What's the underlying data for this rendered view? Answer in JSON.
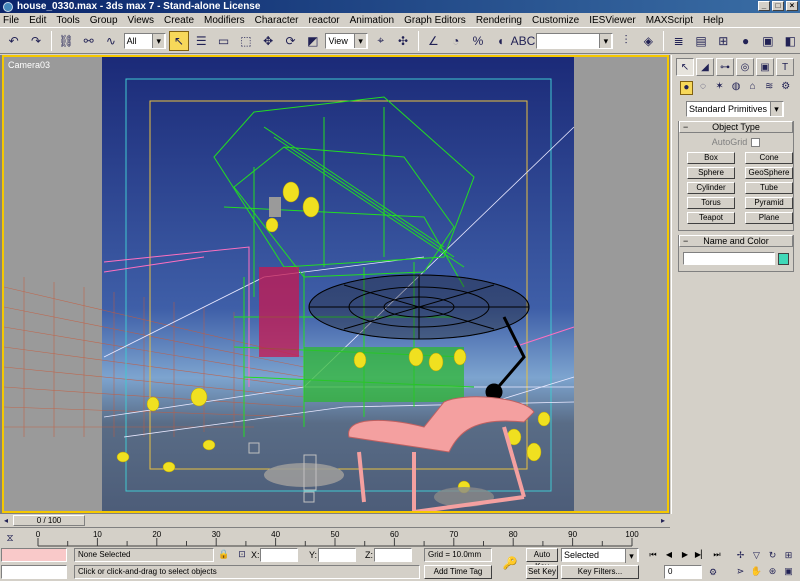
{
  "window": {
    "title": "house_0330.max - 3ds max 7 - Stand-alone License"
  },
  "menu": [
    "File",
    "Edit",
    "Tools",
    "Group",
    "Views",
    "Create",
    "Modifiers",
    "Character",
    "reactor",
    "Animation",
    "Graph Editors",
    "Rendering",
    "Customize",
    "IESViewer",
    "MAXScript",
    "Help"
  ],
  "toolbar": {
    "selection_filter": "All",
    "reference_coord": "View",
    "named_selection": ""
  },
  "viewport": {
    "label": "Camera03",
    "frame_border_color": "#f5c800"
  },
  "command_panel": {
    "category": "Standard Primitives",
    "object_type_title": "Object Type",
    "autogrid_label": "AutoGrid",
    "buttons": [
      "Box",
      "Cone",
      "Sphere",
      "GeoSphere",
      "Cylinder",
      "Tube",
      "Torus",
      "Pyramid",
      "Teapot",
      "Plane"
    ],
    "name_color_title": "Name and Color",
    "object_color": "#40d8b8"
  },
  "timeline": {
    "slider": "0 / 100",
    "ticks": [
      "0",
      "10",
      "20",
      "30",
      "40",
      "50",
      "60",
      "70",
      "80",
      "90",
      "100"
    ]
  },
  "status": {
    "selection_info": "None Selected",
    "prompt": "Click or click-and-drag to select objects",
    "x_label": "X:",
    "y_label": "Y:",
    "z_label": "Z:",
    "grid": "Grid = 10.0mm",
    "add_time_tag": "Add Time Tag",
    "auto_key": "Auto Key",
    "set_key": "Set Key",
    "key_mode": "Selected",
    "key_filters": "Key Filters...",
    "frame": "0"
  }
}
